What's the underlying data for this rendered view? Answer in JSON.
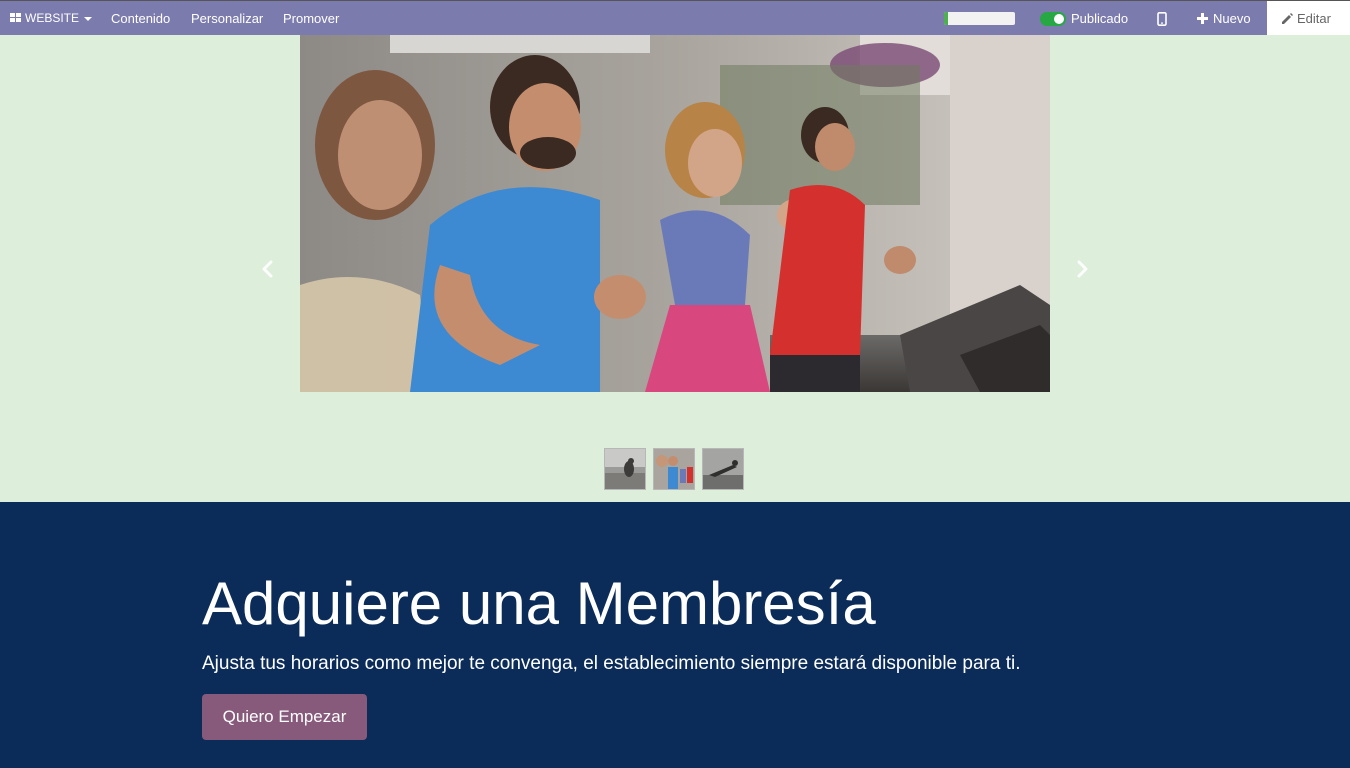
{
  "topbar": {
    "brand_label": "WEBSITE",
    "menu": [
      "Contenido",
      "Personalizar",
      "Promover"
    ],
    "progress_fraction": 0.06,
    "published_label": "Publicado",
    "published_on": true,
    "new_label": "Nuevo",
    "edit_label": "Editar",
    "icons": [
      "apps-grid-icon",
      "caret-down-icon",
      "mobile-preview-icon",
      "plus-icon",
      "pencil-icon"
    ]
  },
  "carousel": {
    "active_slide": 2,
    "slide_count": 3,
    "icons": [
      "chevron-left-icon",
      "chevron-right-icon"
    ]
  },
  "cta": {
    "title": "Adquiere una Membresía",
    "subtitle": "Ajusta tus horarios como mejor te convenga, el establecimiento siempre estará disponible para ti.",
    "button_label": "Quiero Empezar"
  },
  "colors": {
    "topbar_bg": "#7c7bad",
    "carousel_bg": "#ddefda",
    "cta_bg": "#0b2c58",
    "button_bg": "#875a7b",
    "toggle_on": "#28a745"
  }
}
